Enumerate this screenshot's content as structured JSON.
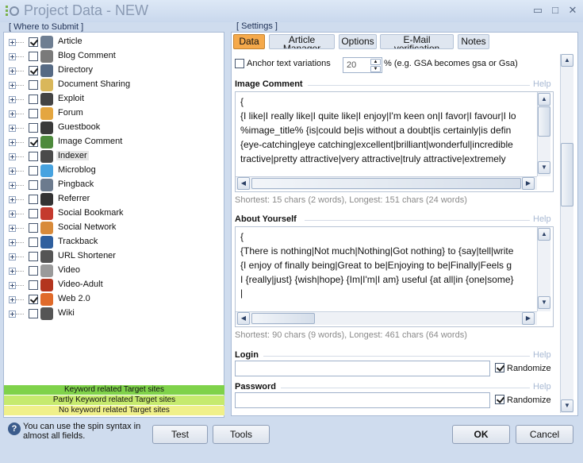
{
  "window": {
    "title": "Project Data - NEW"
  },
  "left_panel": {
    "group_label": "[ Where to Submit ]",
    "items": [
      {
        "label": "Article",
        "checked": true,
        "icon": "article-icon",
        "color": "#6e7e92"
      },
      {
        "label": "Blog Comment",
        "checked": false,
        "icon": "blog-comment-icon",
        "color": "#7a7a7a"
      },
      {
        "label": "Directory",
        "checked": true,
        "icon": "directory-icon",
        "color": "#566a84"
      },
      {
        "label": "Document Sharing",
        "checked": false,
        "icon": "document-sharing-icon",
        "color": "#d9b75a"
      },
      {
        "label": "Exploit",
        "checked": false,
        "icon": "exploit-icon",
        "color": "#444444"
      },
      {
        "label": "Forum",
        "checked": false,
        "icon": "forum-icon",
        "color": "#e4a640"
      },
      {
        "label": "Guestbook",
        "checked": false,
        "icon": "guestbook-icon",
        "color": "#3a3a3a"
      },
      {
        "label": "Image Comment",
        "checked": true,
        "icon": "image-comment-icon",
        "color": "#4d8a3c"
      },
      {
        "label": "Indexer",
        "checked": false,
        "icon": "indexer-icon",
        "color": "#4a4a4a",
        "selected": true
      },
      {
        "label": "Microblog",
        "checked": false,
        "icon": "microblog-icon",
        "color": "#47a3e0"
      },
      {
        "label": "Pingback",
        "checked": false,
        "icon": "pingback-icon",
        "color": "#6c7b8e"
      },
      {
        "label": "Referrer",
        "checked": false,
        "icon": "referrer-icon",
        "color": "#333333"
      },
      {
        "label": "Social Bookmark",
        "checked": false,
        "icon": "social-bookmark-icon",
        "color": "#c43a2e"
      },
      {
        "label": "Social Network",
        "checked": false,
        "icon": "social-network-icon",
        "color": "#d88a3a"
      },
      {
        "label": "Trackback",
        "checked": false,
        "icon": "trackback-icon",
        "color": "#2f5f9e"
      },
      {
        "label": "URL Shortener",
        "checked": false,
        "icon": "url-shortener-icon",
        "color": "#555555"
      },
      {
        "label": "Video",
        "checked": false,
        "icon": "video-icon",
        "color": "#9a9a9a"
      },
      {
        "label": "Video-Adult",
        "checked": false,
        "icon": "video-adult-icon",
        "color": "#b3351f"
      },
      {
        "label": "Web 2.0",
        "checked": true,
        "icon": "web20-icon",
        "color": "#e06a2a"
      },
      {
        "label": "Wiki",
        "checked": false,
        "icon": "wiki-icon",
        "color": "#555555"
      }
    ],
    "legend": [
      {
        "label": "Keyword related Target sites",
        "color": "#7fd24a"
      },
      {
        "label": "Partly Keyword related Target sites",
        "color": "#c6ea6e"
      },
      {
        "label": "No keyword related Target sites",
        "color": "#f0f08a"
      }
    ]
  },
  "right_panel": {
    "group_label": "[ Settings ]",
    "tabs": [
      "Data",
      "Article Manager",
      "Options",
      "E-Mail verification",
      "Notes"
    ],
    "active_tab": "Data",
    "anchor_label": "Anchor text variations",
    "anchor_value": "20",
    "anchor_suffix": "% (e.g. GSA becomes gsa or Gsa)",
    "image_comment": {
      "title": "Image Comment",
      "help": "Help",
      "lines": [
        "{",
        "{I like|I really like|I quite like|I enjoy|I'm keen on|I favor|I favour|I lo",
        "%image_title% {is|could be|is without a doubt|is certainly|is defin",
        "{eye-catching|eye catching|excellent|brilliant|wonderful|incredible",
        "tractive|pretty attractive|very attractive|truly attractive|extremely"
      ],
      "stats": "Shortest: 15 chars (2 words), Longest: 151 chars (24 words)"
    },
    "about_yourself": {
      "title": "About Yourself",
      "help": "Help",
      "lines": [
        "{",
        "{There is nothing|Not much|Nothing|Got nothing} to {say|tell|write",
        "{I enjoy of finally being|Great to be|Enjoying to be|Finally|Feels g",
        "I {really|just} {wish|hope} {Im|I'm|I am} useful {at all|in {one|some}",
        "|"
      ],
      "stats": "Shortest: 90 chars (9 words), Longest: 461 chars (64 words)"
    },
    "login": {
      "title": "Login",
      "help": "Help",
      "value": "",
      "randomize_label": "Randomize",
      "randomize": true
    },
    "password": {
      "title": "Password",
      "help": "Help",
      "value": "",
      "randomize_label": "Randomize",
      "randomize": true
    }
  },
  "footer": {
    "hint": "You can use the spin syntax in almost all fields.",
    "buttons": {
      "test": "Test",
      "tools": "Tools",
      "ok": "OK",
      "cancel": "Cancel"
    }
  }
}
